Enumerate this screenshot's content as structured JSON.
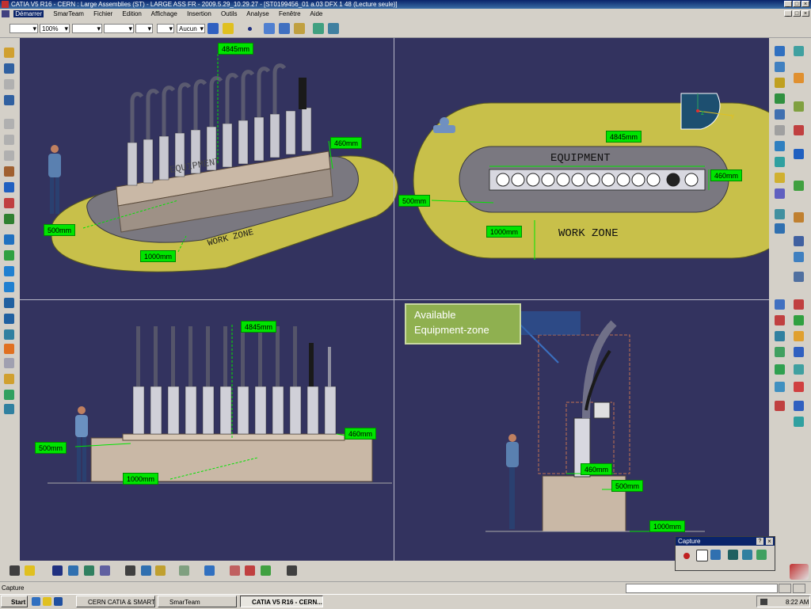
{
  "window": {
    "title": "CATIA V5 R16 - CERN : Large Assemblies (ST) - LARGE ASS FR - 2009.5.29_10.29.27 - [ST0199456_01 a.03 DFX 1 48 (Lecture seule)]",
    "controls": [
      "_",
      "□",
      "×"
    ]
  },
  "menu": [
    "Démarrer",
    "SmarTeam",
    "Fichier",
    "Edition",
    "Affichage",
    "Insertion",
    "Outils",
    "Analyse",
    "Fenêtre",
    "Aide"
  ],
  "toolbar": {
    "zoom": "100%",
    "line_type": "Aucun"
  },
  "viewport": {
    "top_left": {
      "labels": {
        "width": "4845mm",
        "depth": "460mm",
        "clearance": "500mm",
        "zone": "1000mm"
      },
      "floor_text": "WORK ZONE",
      "equip_text": "EQUIPMENT"
    },
    "top_right": {
      "labels": {
        "width": "4845mm",
        "depth": "460mm",
        "clearance": "500mm",
        "zone": "1000mm"
      },
      "equip_text": "EQUIPMENT",
      "floor_text": "WORK ZONE"
    },
    "bottom_left": {
      "labels": {
        "width": "4845mm",
        "depth": "460mm",
        "clearance": "500mm",
        "zone": "1000mm"
      }
    },
    "bottom_right": {
      "callout": {
        "line1": "Available",
        "line2": "Equipment-zone"
      },
      "labels": {
        "depth": "460mm",
        "clearance": "500mm",
        "zone": "1000mm"
      }
    }
  },
  "compass": {
    "z": "z",
    "y": "y"
  },
  "capture_toolbar": {
    "title": "Capture",
    "help": "?",
    "close": "×"
  },
  "status": {
    "text": "Capture"
  },
  "taskbar": {
    "start": "Start",
    "items": [
      "CERN CATIA & SMARTE...",
      "SmarTeam",
      "CATIA V5 R16 - CERN..."
    ],
    "clock": "8:22 AM"
  },
  "colors": {
    "viewport_bg": "#33335f",
    "dim_label": "#00e400",
    "callout": "#8fb050",
    "workzone": "#c8c04a"
  }
}
